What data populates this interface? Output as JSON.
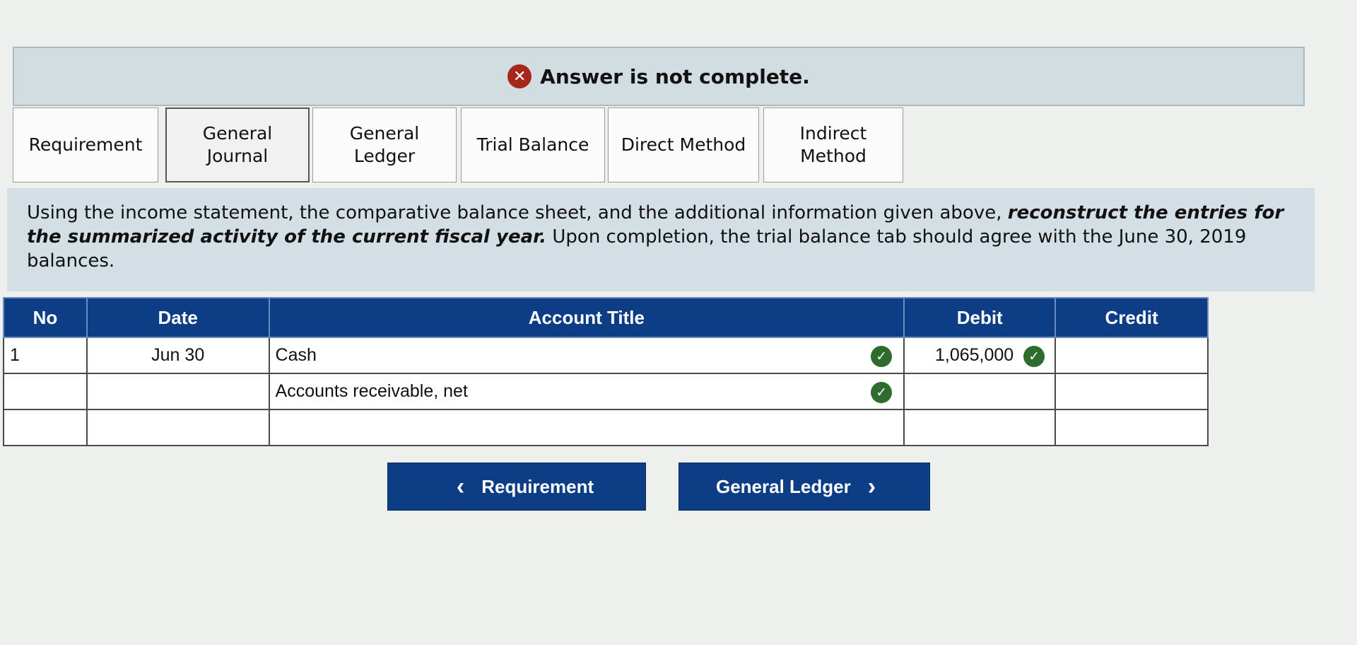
{
  "banner": {
    "icon": "x-circle-icon",
    "message": "Answer is not complete."
  },
  "tabs": [
    {
      "label": "Requirement"
    },
    {
      "label": "General Journal",
      "line1": "General",
      "line2": "Journal",
      "active": true
    },
    {
      "label": "General Ledger",
      "line1": "General",
      "line2": "Ledger"
    },
    {
      "label": "Trial Balance"
    },
    {
      "label": "Direct Method"
    },
    {
      "label": "Indirect Method",
      "line1": "Indirect",
      "line2": "Method"
    }
  ],
  "instructions": {
    "text_before": "Using the income statement, the comparative balance sheet, and the additional information given above, ",
    "emphasis": "reconstruct the entries for the summarized activity of the current fiscal year.",
    "text_after": " Upon completion, the trial balance tab should agree with the June 30, 2019 balances."
  },
  "journal": {
    "headers": {
      "no": "No",
      "date": "Date",
      "account_title": "Account Title",
      "debit": "Debit",
      "credit": "Credit"
    },
    "rows": [
      {
        "no": "1",
        "date": "Jun 30",
        "account": "Cash",
        "account_correct": true,
        "debit": "1,065,000",
        "debit_correct": true,
        "credit": ""
      },
      {
        "no": "",
        "date": "",
        "account": "Accounts receivable, net",
        "account_correct": true,
        "debit": "",
        "credit": ""
      },
      {
        "no": "",
        "date": "",
        "account": "",
        "debit": "",
        "credit": ""
      }
    ]
  },
  "navigation": {
    "prev_label": "Requirement",
    "next_label": "General Ledger"
  },
  "colors": {
    "header_blue": "#0c3d85",
    "error_red": "#a6261c",
    "check_green": "#2e6b2d",
    "panel_blue_gray": "#d3dfe4"
  }
}
